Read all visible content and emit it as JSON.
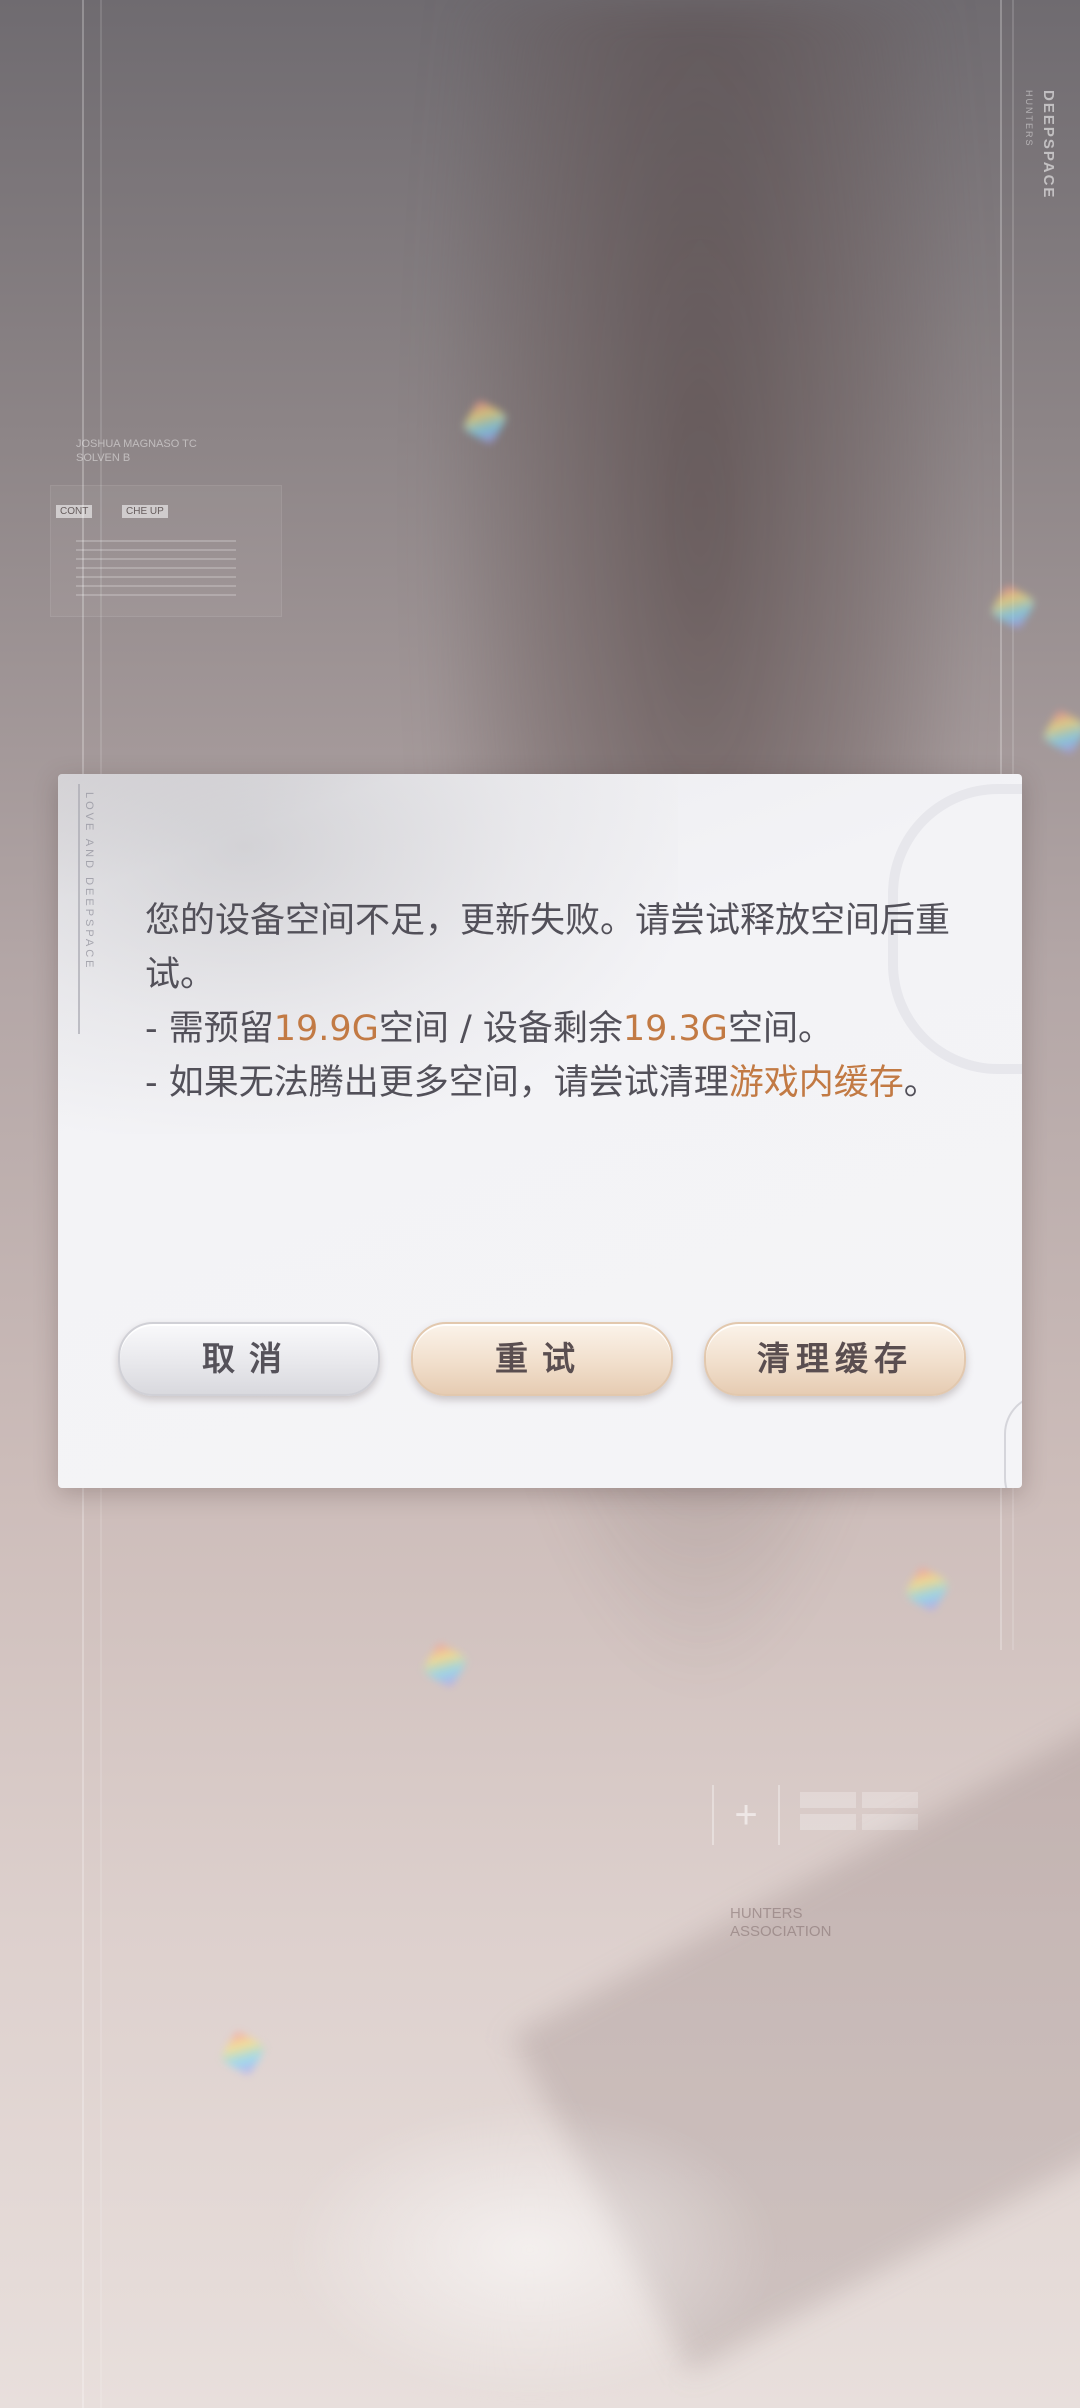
{
  "background": {
    "brand": "DEEPSPACE",
    "brand_sub": "HUNTERS",
    "deco_line1": "JOSHUA MAGNASO TC",
    "deco_line2": "SOLVEN B",
    "tag1": "CONT",
    "tag2": "CHE UP",
    "org_line1": "HUNTERS",
    "org_line2": "ASSOCIATION",
    "plus_symbol": "+"
  },
  "dialog": {
    "side_text": "LOVE AND DEEPSPACE",
    "message": {
      "line1": "您的设备空间不足，更新失败。请尝试释放空间后重试。",
      "line2_prefix": "- 需预留",
      "required_space": "19.9G",
      "line2_middle": "空间 / 设备剩余",
      "remaining_space": "19.3G",
      "line2_suffix": "空间。",
      "line3_prefix": "- 如果无法腾出更多空间，请尝试清理",
      "line3_link": "游戏内缓存",
      "line3_suffix": "。"
    },
    "buttons": {
      "cancel": "取消",
      "retry": "重试",
      "clear_cache": "清理缓存"
    }
  },
  "colors": {
    "accent": "#c27a44",
    "text": "#525059",
    "button_warm": "#f1dfcc",
    "button_neutral": "#e8e8ec"
  }
}
